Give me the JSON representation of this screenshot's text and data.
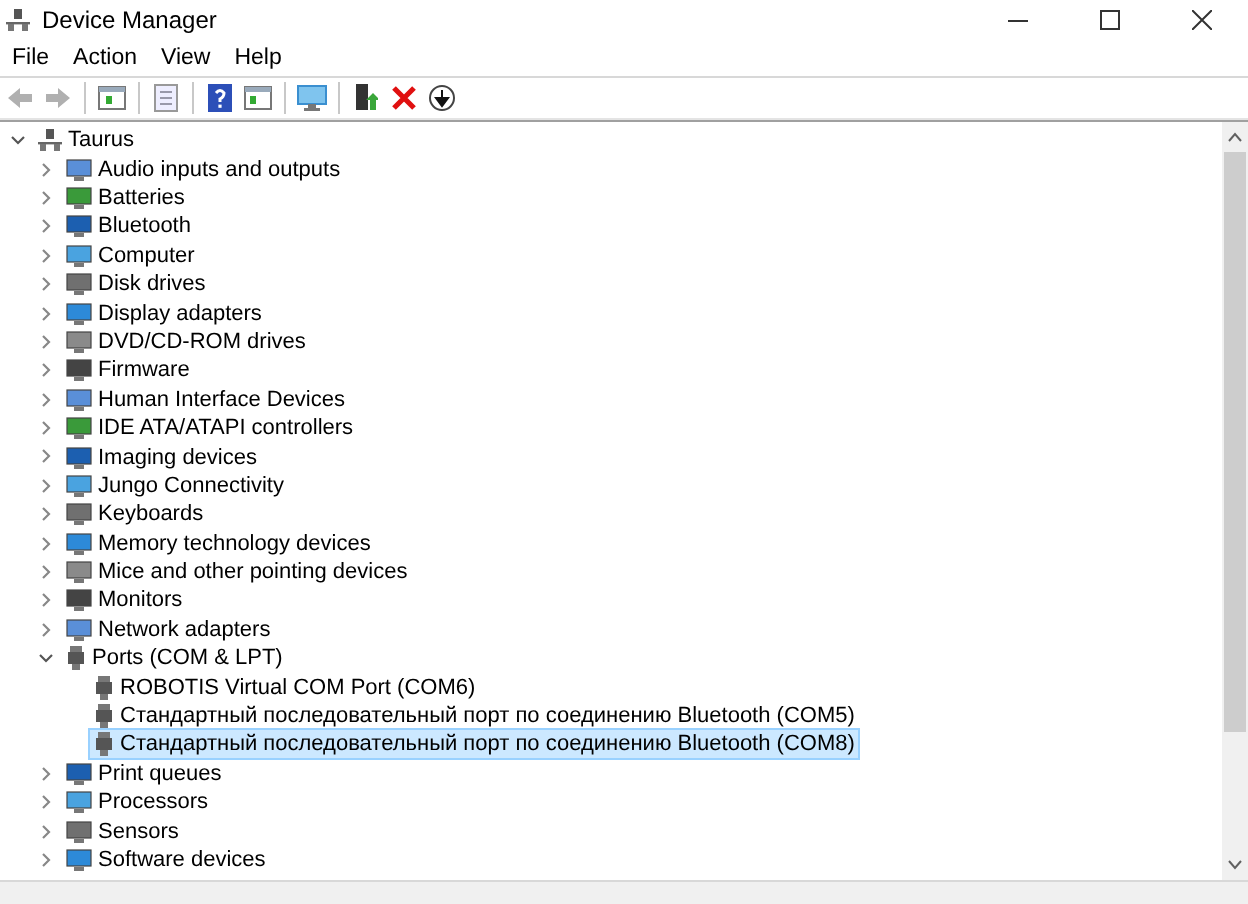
{
  "window": {
    "title": "Device Manager"
  },
  "menu": [
    "File",
    "Action",
    "View",
    "Help"
  ],
  "tree": [
    {
      "label": "Taurus",
      "expanded": true,
      "selected": false,
      "children": [
        {
          "label": "Audio inputs and outputs",
          "expanded": false,
          "selected": false
        },
        {
          "label": "Batteries",
          "expanded": false,
          "selected": false
        },
        {
          "label": "Bluetooth",
          "expanded": false,
          "selected": false
        },
        {
          "label": "Computer",
          "expanded": false,
          "selected": false
        },
        {
          "label": "Disk drives",
          "expanded": false,
          "selected": false
        },
        {
          "label": "Display adapters",
          "expanded": false,
          "selected": false
        },
        {
          "label": "DVD/CD-ROM drives",
          "expanded": false,
          "selected": false
        },
        {
          "label": "Firmware",
          "expanded": false,
          "selected": false
        },
        {
          "label": "Human Interface Devices",
          "expanded": false,
          "selected": false
        },
        {
          "label": "IDE ATA/ATAPI controllers",
          "expanded": false,
          "selected": false
        },
        {
          "label": "Imaging devices",
          "expanded": false,
          "selected": false
        },
        {
          "label": "Jungo Connectivity",
          "expanded": false,
          "selected": false
        },
        {
          "label": "Keyboards",
          "expanded": false,
          "selected": false
        },
        {
          "label": "Memory technology devices",
          "expanded": false,
          "selected": false
        },
        {
          "label": "Mice and other pointing devices",
          "expanded": false,
          "selected": false
        },
        {
          "label": "Monitors",
          "expanded": false,
          "selected": false
        },
        {
          "label": "Network adapters",
          "expanded": false,
          "selected": false
        },
        {
          "label": "Ports (COM & LPT)",
          "expanded": true,
          "selected": false,
          "children": [
            {
              "label": "ROBOTIS Virtual COM Port (COM6)",
              "selected": false
            },
            {
              "label": "Стандартный последовательный порт по соединению Bluetooth (COM5)",
              "selected": false
            },
            {
              "label": "Стандартный последовательный порт по соединению Bluetooth (COM8)",
              "selected": true
            }
          ]
        },
        {
          "label": "Print queues",
          "expanded": false,
          "selected": false
        },
        {
          "label": "Processors",
          "expanded": false,
          "selected": false
        },
        {
          "label": "Sensors",
          "expanded": false,
          "selected": false
        },
        {
          "label": "Software devices",
          "expanded": false,
          "selected": false
        }
      ]
    }
  ]
}
